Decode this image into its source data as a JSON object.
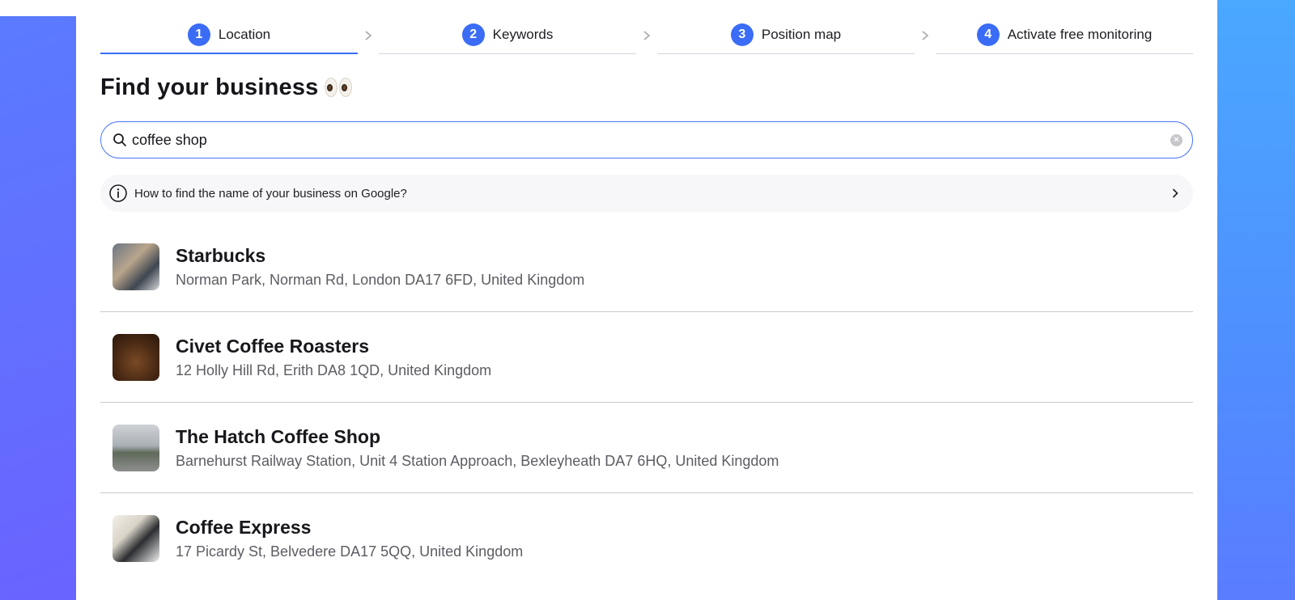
{
  "stepper": {
    "steps": [
      {
        "number": "1",
        "label": "Location",
        "active": true
      },
      {
        "number": "2",
        "label": "Keywords",
        "active": false
      },
      {
        "number": "3",
        "label": "Position map",
        "active": false
      },
      {
        "number": "4",
        "label": "Activate free monitoring",
        "active": false
      }
    ]
  },
  "heading": {
    "title": "Find your business",
    "emoji": "eyes-emoji"
  },
  "search": {
    "value": "coffee shop",
    "icon": "search-icon",
    "clear_icon": "clear-icon"
  },
  "info": {
    "text": "How to find the name of your business on Google?",
    "icon": "info-icon",
    "chevron": "chevron-right-icon"
  },
  "results": [
    {
      "name": "Starbucks",
      "address": "Norman Park, Norman Rd, London DA17 6FD, United Kingdom"
    },
    {
      "name": "Civet Coffee Roasters",
      "address": "12 Holly Hill Rd, Erith DA8 1QD, United Kingdom"
    },
    {
      "name": "The Hatch Coffee Shop",
      "address": "Barnehurst Railway Station, Unit 4 Station Approach, Bexleyheath DA7 6HQ, United Kingdom"
    },
    {
      "name": "Coffee Express",
      "address": "17 Picardy St, Belvedere DA17 5QQ, United Kingdom"
    }
  ],
  "colors": {
    "accent": "#3b6cf6",
    "background_left": "#6a63ff",
    "background_right": "#4aa8ff"
  }
}
